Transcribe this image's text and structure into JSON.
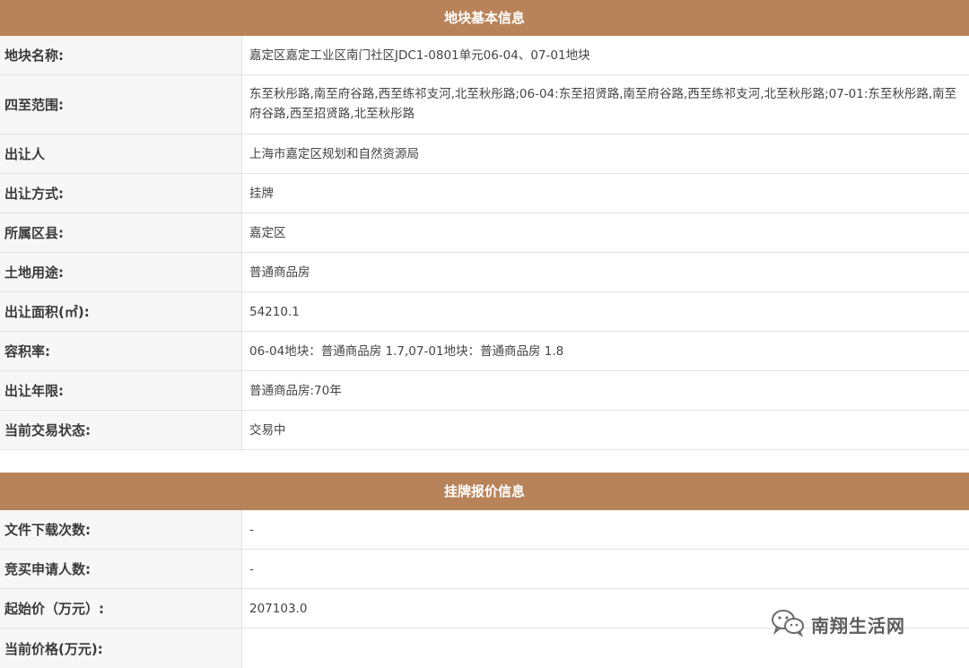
{
  "section1": {
    "title": "地块基本信息",
    "rows": [
      {
        "label": "地块名称:",
        "value": "嘉定区嘉定工业区南门社区JDC1-0801单元06-04、07-01地块"
      },
      {
        "label": "四至范围:",
        "value": "东至秋彤路,南至府谷路,西至练祁支河,北至秋彤路;06-04:东至招贤路,南至府谷路,西至练祁支河,北至秋彤路;07-01:东至秋彤路,南至府谷路,西至招贤路,北至秋彤路"
      },
      {
        "label": "出让人",
        "value": "上海市嘉定区规划和自然资源局"
      },
      {
        "label": "出让方式:",
        "value": "挂牌"
      },
      {
        "label": "所属区县:",
        "value": "嘉定区"
      },
      {
        "label": "土地用途:",
        "value": "普通商品房"
      },
      {
        "label": "出让面积(㎡):",
        "value": "54210.1"
      },
      {
        "label": "容积率:",
        "value": "06-04地块：普通商品房 1.7,07-01地块：普通商品房 1.8"
      },
      {
        "label": "出让年限:",
        "value": "普通商品房:70年"
      },
      {
        "label": "当前交易状态:",
        "value": "交易中"
      }
    ]
  },
  "section2": {
    "title": "挂牌报价信息",
    "rows": [
      {
        "label": "文件下载次数:",
        "value": "-"
      },
      {
        "label": "竞买申请人数:",
        "value": "-"
      },
      {
        "label": "起始价（万元）:",
        "value": "207103.0"
      },
      {
        "label": "当前价格(万元):",
        "value": ""
      }
    ]
  },
  "watermark": {
    "text": "南翔生活网",
    "icon": "wechat-icon"
  },
  "colors": {
    "header": "#b9835a",
    "label_bg": "#f7f7f7",
    "border": "#e2e2e2"
  }
}
